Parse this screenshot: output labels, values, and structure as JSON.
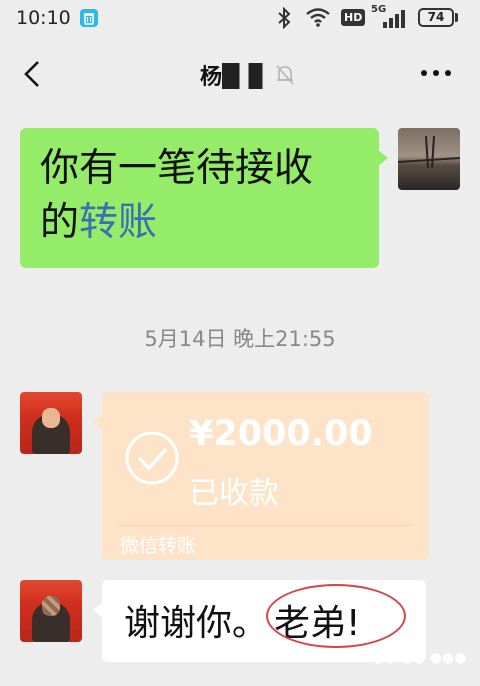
{
  "status_bar": {
    "time": "10:10",
    "network_label": "HD",
    "signal_label": "5G",
    "battery": "74"
  },
  "nav": {
    "title": "杨",
    "back_icon": "chevron-left-icon",
    "mute_icon": "bell-off-icon",
    "more_icon": "ellipsis-icon"
  },
  "messages": {
    "sent_text_1": "你有一笔待接收",
    "sent_text_2a": "的",
    "sent_text_2b": "转账",
    "timestamp": "5月14日 晚上21:55",
    "transfer": {
      "amount": "¥2000.00",
      "status": "已收款",
      "footer": "微信转账"
    },
    "reply_part1": "谢谢你。",
    "reply_part2": "老弟!"
  },
  "colors": {
    "sent_bubble": "#95ec69",
    "transfer_card": "#fde4c9",
    "highlight_word": "#3b6fb0",
    "annotation_ring": "#d84545",
    "background": "#ededed"
  }
}
